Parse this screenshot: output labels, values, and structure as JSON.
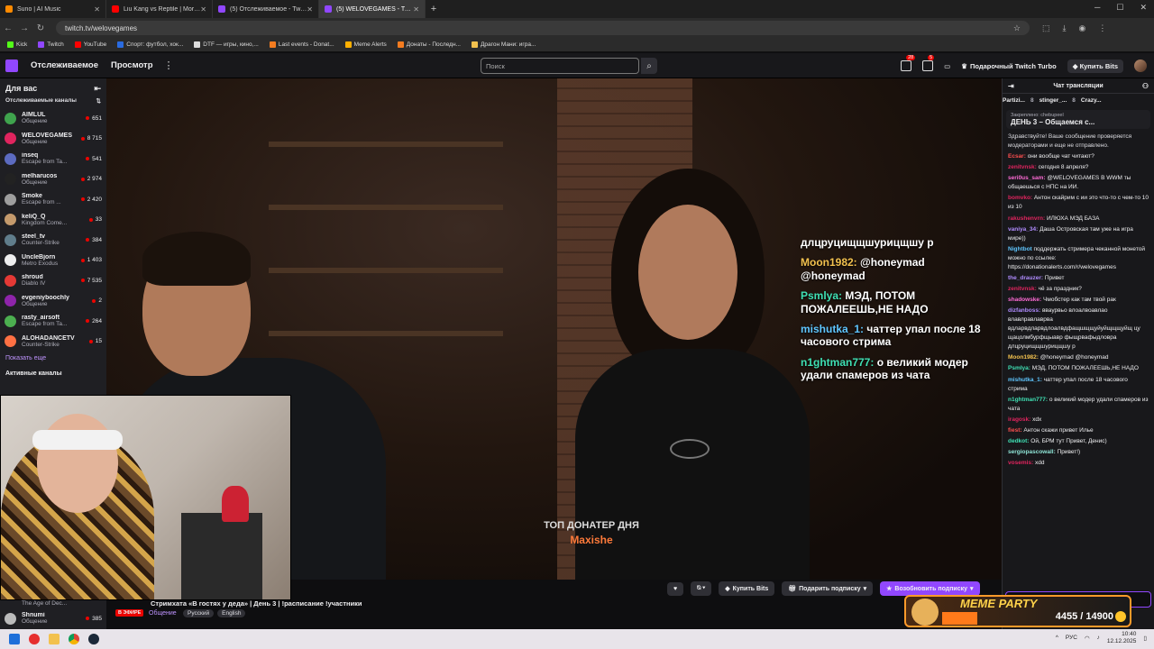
{
  "browser": {
    "tabs": [
      {
        "title": "Suno | AI Music",
        "color": "#ff8a00"
      },
      {
        "title": "Liu Kang vs Reptile | Mortal Kombat",
        "color": "#ff0000"
      },
      {
        "title": "(5) Отслеживаемое - Twitch",
        "color": "#9147ff"
      },
      {
        "title": "(5) WELOVEGAMES - Twitch",
        "color": "#9147ff",
        "active": true
      }
    ],
    "url": "twitch.tv/welovegames",
    "bookmarks": [
      {
        "label": "Kick",
        "color": "#53fc18"
      },
      {
        "label": "Twitch",
        "color": "#9147ff"
      },
      {
        "label": "YouTube",
        "color": "#ff0000"
      },
      {
        "label": "Спорт: футбол, хок...",
        "color": "#2a6be0"
      },
      {
        "label": "DTF — игры, кино,...",
        "color": "#ddd"
      },
      {
        "label": "Last events - Donat...",
        "color": "#f47c20"
      },
      {
        "label": "Meme Alerts",
        "color": "#ffb000"
      },
      {
        "label": "Донаты - Последн...",
        "color": "#f47c20"
      },
      {
        "label": "Драгон Мани: игра...",
        "color": "#f2c14e"
      }
    ]
  },
  "topnav": {
    "following": "Отслеживаемое",
    "browse": "Просмотр",
    "search_placeholder": "Поиск",
    "badge1": "28",
    "badge2": "5",
    "turbo": "Подарочный Twitch Turbo",
    "buy_bits": "Купить Bits"
  },
  "sidebar": {
    "for_you": "Для вас",
    "followed": "Отслеживаемые каналы",
    "channels": [
      {
        "name": "AIMLUL",
        "game": "Общение",
        "viewers": "651",
        "color": "#3fa34d"
      },
      {
        "name": "WELOVEGAMES",
        "game": "Общение",
        "viewers": "8 715",
        "color": "#e0245e"
      },
      {
        "name": "inseq",
        "game": "Escape from Ta...",
        "viewers": "541",
        "color": "#5c6bc0"
      },
      {
        "name": "melharucos",
        "game": "Общение",
        "viewers": "2 974",
        "color": "#222"
      },
      {
        "name": "Smoke",
        "game": "Escape from ...",
        "viewers": "2 420",
        "color": "#9e9e9e"
      },
      {
        "name": "keliQ_Q",
        "game": "Kingdom Come...",
        "viewers": "33",
        "color": "#c49a6c"
      },
      {
        "name": "steel_tv",
        "game": "Counter-Strike",
        "viewers": "384",
        "color": "#607d8b"
      },
      {
        "name": "UncleBjorn",
        "game": "Metro Exodus",
        "viewers": "1 403",
        "color": "#eee"
      },
      {
        "name": "shroud",
        "game": "Diablo IV",
        "viewers": "7 535",
        "color": "#e53935"
      },
      {
        "name": "evgeniyboochly",
        "game": "Общение",
        "viewers": "2",
        "color": "#8e24aa"
      },
      {
        "name": "rasty_airsoft",
        "game": "Escape from Ta...",
        "viewers": "264",
        "color": "#4caf50"
      },
      {
        "name": "ALOHADANCETV",
        "game": "Counter-Strike",
        "viewers": "15",
        "color": "#ff7043"
      }
    ],
    "show_more": "Показать еще",
    "active_channels": "Активные каналы",
    "bottom_channel": {
      "name": "Shnumi",
      "game": "Общение",
      "viewers": "385",
      "color": "#bbb"
    },
    "partial_game": "The Age of Dec..."
  },
  "player": {
    "overlay": [
      {
        "user": "",
        "text": "длцруцищщшурицщшу р"
      },
      {
        "user": "Moon1982:",
        "text": "@honeymad @honeymad"
      },
      {
        "user": "Psmlya:",
        "text": "МЭД, ПОТОМ ПОЖАЛЕЕШЬ,НЕ НАДО"
      },
      {
        "user": "mishutka_1:",
        "text": "чаттер упал после 18 часового стрима"
      },
      {
        "user": "n1ghtman777:",
        "text": "о великий модер удали спамеров из чата"
      }
    ],
    "donater_label": "ТОП ДОНАТЕР ДНЯ",
    "donater_name": "Maxishe"
  },
  "controls": {
    "buy_bits": "Купить Bits",
    "gift_sub": "Подарить подписку",
    "resub": "Возобновить подписку"
  },
  "stream": {
    "live": "В ЭФИРЕ",
    "title": "Стримхата «В гостях у деда» | День 3 | !расписание !участники",
    "category": "Общение",
    "tags": [
      "Русский",
      "English"
    ]
  },
  "chat": {
    "header": "Чат трансляции",
    "gifters": [
      "Partizi...",
      "8",
      "stinger_...",
      "8",
      "Crazy..."
    ],
    "pinned_by": "Закреплено: chebupeel",
    "pinned": "ДЕНЬ 3 – Общаемся с...",
    "messages": [
      {
        "user": "",
        "color": "#dedee3",
        "text": "Здравствуйте! Ваше сообщение проверяется модераторами и еще не отправлено."
      },
      {
        "user": "Ecsar:",
        "color": "#ff4f4f",
        "text": "они вообще чат читают?"
      },
      {
        "user": "zenitvnsk:",
        "color": "#e0245e",
        "text": "сегодня 8 апреля?"
      },
      {
        "user": "seri0us_sam:",
        "color": "#ff6bd6",
        "text": "@WELOVEGAMES В WWM ты общаешься с НПС на ИИ."
      },
      {
        "user": "bomvko:",
        "color": "#e0245e",
        "text": "Антон скайрим с ии это что-то с чем-то 10 из 10"
      },
      {
        "user": "rakushenvrn:",
        "color": "#e0245e",
        "text": "ИЛЮХА МЭД БАЗА"
      },
      {
        "user": "vaniya_34:",
        "color": "#b08cff",
        "text": "Даша Островская там уже на игра мире))"
      },
      {
        "user": "Nightbot",
        "color": "#5fc6ff",
        "text": "поддержать стримера чеканной монетой можно по ссылке: https://donationalerts.com/r/welovegames"
      },
      {
        "user": "the_drauzer:",
        "color": "#b08cff",
        "text": "Привет"
      },
      {
        "user": "zenitvnsk:",
        "color": "#e0245e",
        "text": "чё за праздник?"
      },
      {
        "user": "shadowske:",
        "color": "#ff6bd6",
        "text": "Чмобстер как там твой рак"
      },
      {
        "user": "dizfanboss:",
        "color": "#b08cff",
        "text": "вваурвьо влоалвоавлао влавлравлаврва вдларвдларвдлоалвдфащшщщуйуйщщщуйщ цу щацолмбурфщыавр фыщрвафыдловра длцруцищщшурицщшу р"
      },
      {
        "user": "Moon1982:",
        "color": "#f2c14e",
        "text": "@honeymad @honeymad"
      },
      {
        "user": "Psmlya:",
        "color": "#3fe0b4",
        "text": "МЭД, ПОТОМ ПОЖАЛЕЕШЬ,НЕ НАДО"
      },
      {
        "user": "mishutka_1:",
        "color": "#5fc6ff",
        "text": "чаттер упал после 18 часового стрима"
      },
      {
        "user": "n1ghtman777:",
        "color": "#3fe0b4",
        "text": "о великий модер удали спамеров из чата"
      },
      {
        "user": "iragosk:",
        "color": "#e0245e",
        "text": "xdx"
      },
      {
        "user": "fiest:",
        "color": "#ff4f4f",
        "text": "Антон скажи привет Илье"
      },
      {
        "user": "dedkot:",
        "color": "#3fe0b4",
        "text": "Ой, БРМ тут Привет, Денис)"
      },
      {
        "user": "sergiopascowall:",
        "color": "#8ee3d5",
        "text": "Привет!)"
      },
      {
        "user": "vosemis:",
        "color": "#e0245e",
        "text": "xdd"
      }
    ]
  },
  "meme": {
    "title": "MEME PARTY",
    "count": "4455 / 14900",
    "progress": 0.3
  },
  "taskbar": {
    "lang": "РУС",
    "time": "10:40",
    "date": "12.12.2025"
  }
}
